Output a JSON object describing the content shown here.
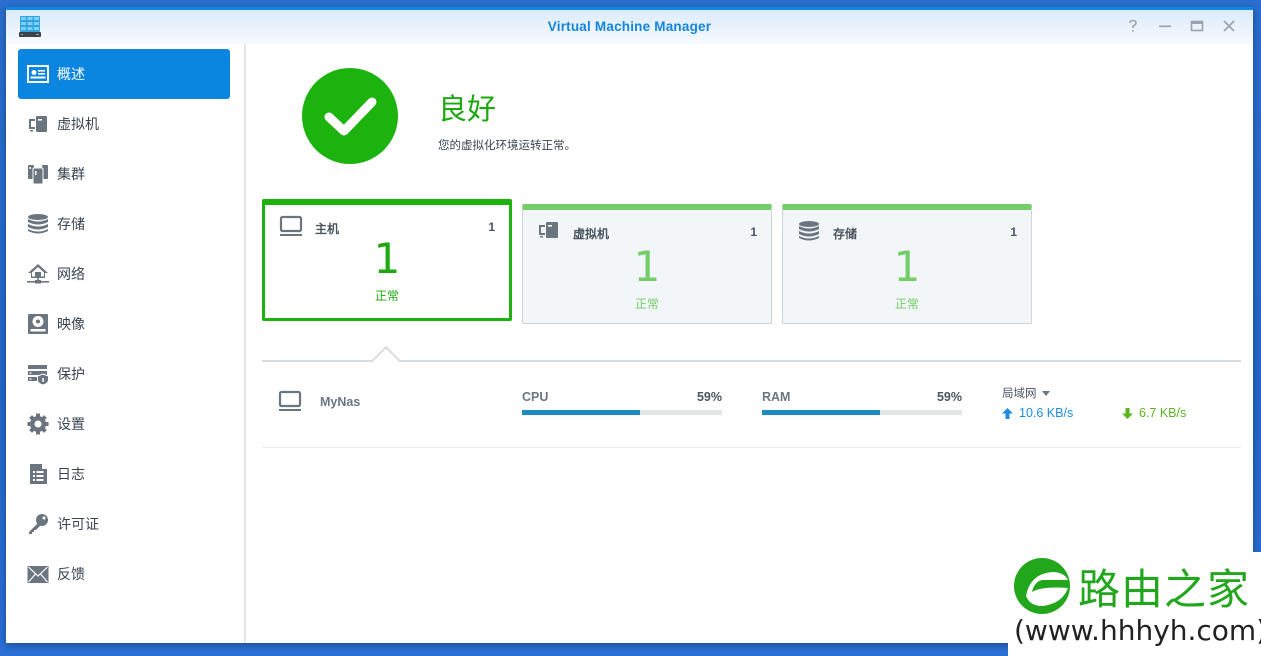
{
  "window": {
    "title": "Virtual Machine Manager",
    "controls": [
      "help-icon",
      "minimize-icon",
      "maximize-icon",
      "close-icon"
    ]
  },
  "sidebar": {
    "items": [
      {
        "label": "概述",
        "icon": "overview-icon",
        "active": true
      },
      {
        "label": "虚拟机",
        "icon": "virtual-machine-icon",
        "active": false
      },
      {
        "label": "集群",
        "icon": "cluster-icon",
        "active": false
      },
      {
        "label": "存储",
        "icon": "storage-icon",
        "active": false
      },
      {
        "label": "网络",
        "icon": "network-icon",
        "active": false
      },
      {
        "label": "映像",
        "icon": "image-icon",
        "active": false
      },
      {
        "label": "保护",
        "icon": "protection-icon",
        "active": false
      },
      {
        "label": "设置",
        "icon": "gear-icon",
        "active": false
      },
      {
        "label": "日志",
        "icon": "log-icon",
        "active": false
      },
      {
        "label": "许可证",
        "icon": "key-icon",
        "active": false
      },
      {
        "label": "反馈",
        "icon": "envelope-icon",
        "active": false
      }
    ]
  },
  "status": {
    "title": "良好",
    "description": "您的虚拟化环境运转正常。",
    "icon": "check-circle-icon",
    "color": "#1db30f"
  },
  "cards": [
    {
      "name": "主机",
      "count": "1",
      "big": "1",
      "status": "正常",
      "icon": "host-icon",
      "selected": true
    },
    {
      "name": "虚拟机",
      "count": "1",
      "big": "1",
      "status": "正常",
      "icon": "virtual-machine-icon",
      "selected": false
    },
    {
      "name": "存储",
      "count": "1",
      "big": "1",
      "status": "正常",
      "icon": "storage-icon",
      "selected": false
    }
  ],
  "host": {
    "name": "MyNas",
    "cpu": {
      "label": "CPU",
      "value": "59%",
      "percent": 59
    },
    "ram": {
      "label": "RAM",
      "value": "59%",
      "percent": 59
    },
    "network": {
      "selected": "局域网",
      "upload": "10.6 KB/s",
      "download": "6.7 KB/s"
    }
  },
  "colors": {
    "accent": "#0a86e0",
    "ok_green": "#1db30f",
    "ok_light": "#73cd68",
    "bar_fill": "#1c8ac2",
    "upload": "#1e8ce0",
    "download": "#5cb51e"
  },
  "watermark": {
    "title": "路由之家",
    "url": "(www.hhhyh.com)"
  }
}
